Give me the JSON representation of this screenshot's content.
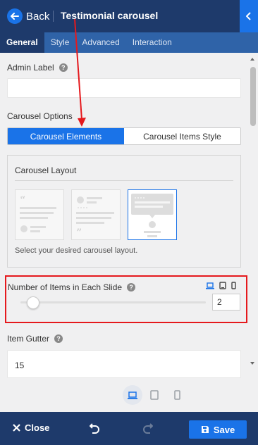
{
  "header": {
    "back_label": "Back",
    "title": "Testimonial carousel"
  },
  "tabs": [
    {
      "label": "General",
      "active": true
    },
    {
      "label": "Style",
      "active": false
    },
    {
      "label": "Advanced",
      "active": false
    },
    {
      "label": "Interaction",
      "active": false
    }
  ],
  "admin_label": {
    "label": "Admin Label",
    "value": ""
  },
  "carousel_options": {
    "label": "Carousel Options",
    "segments": [
      "Carousel Elements",
      "Carousel Items Style"
    ],
    "active_segment": "Carousel Elements"
  },
  "carousel_layout": {
    "title": "Carousel Layout",
    "hint": "Select your desired carousel layout.",
    "options": [
      "layout-1",
      "layout-2",
      "layout-3"
    ],
    "selected": "layout-3"
  },
  "items_per_slide": {
    "label": "Number of Items in Each Slide",
    "value": "2",
    "slider_fraction": 0.07
  },
  "item_gutter": {
    "label": "Item Gutter",
    "value": "15"
  },
  "footer": {
    "close_label": "Close",
    "save_label": "Save"
  },
  "colors": {
    "header": "#1e3a6b",
    "tabs": "#2f63a8",
    "accent": "#1a73e8",
    "highlight": "#e5191d"
  },
  "icons": [
    "back-arrow-icon",
    "chevron-left-icon",
    "help-icon",
    "laptop-icon",
    "tablet-icon",
    "phone-icon",
    "close-icon",
    "undo-icon",
    "redo-icon",
    "save-icon"
  ]
}
